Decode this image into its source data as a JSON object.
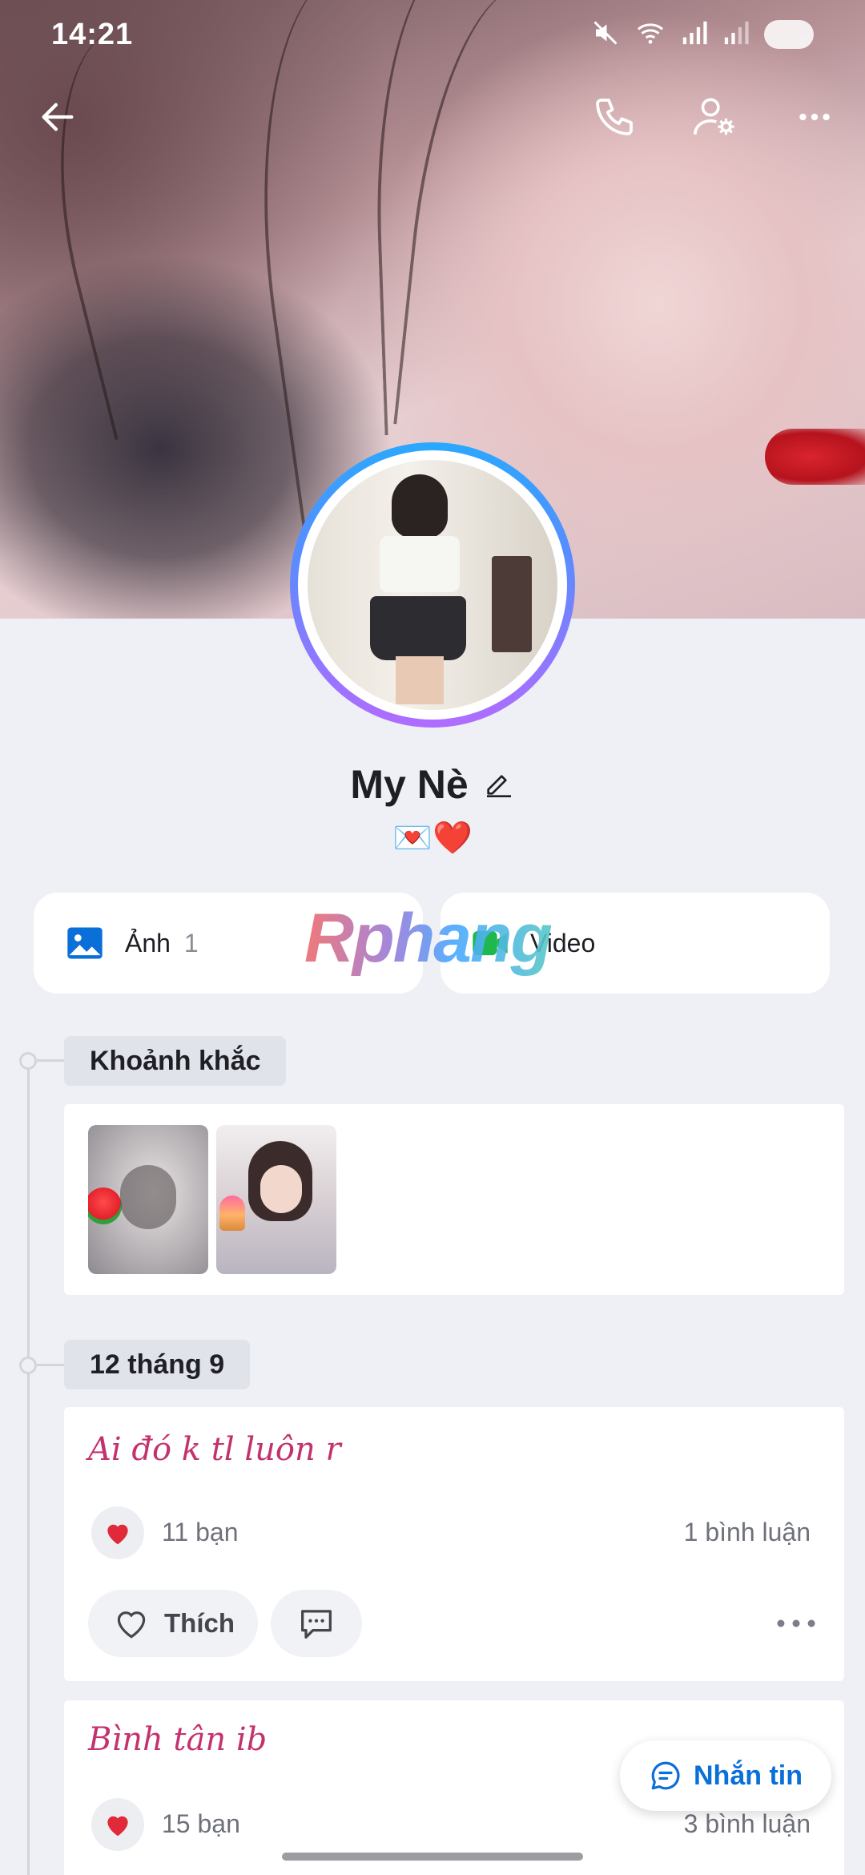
{
  "status_bar": {
    "time": "14:21"
  },
  "profile": {
    "name": "My Nè",
    "bio": "💌❤️"
  },
  "media": {
    "photos": {
      "label": "Ảnh",
      "count": "1"
    },
    "videos": {
      "label": "Video"
    }
  },
  "watermark": "Rphang",
  "timeline": {
    "moments": {
      "title": "Khoảnh khắc"
    },
    "post1": {
      "date": "12 tháng 9",
      "text": "Ai đó k tl luôn r",
      "likes": "11 bạn",
      "comments": "1 bình luận",
      "like_label": "Thích"
    },
    "post2": {
      "text": "Bình tân ib",
      "likes": "15 bạn",
      "comments": "3 bình luận"
    }
  },
  "fab": {
    "label": "Nhắn tin"
  },
  "colors": {
    "accent": "#0a6fd8",
    "post_text": "#c4326e",
    "background": "#eff0f5"
  }
}
